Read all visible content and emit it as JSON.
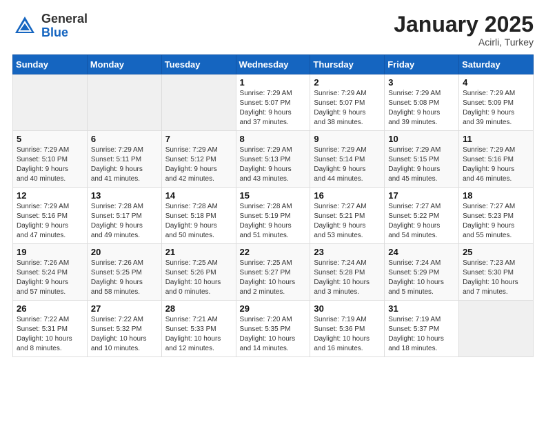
{
  "logo": {
    "general": "General",
    "blue": "Blue"
  },
  "header": {
    "month": "January 2025",
    "location": "Acirli, Turkey"
  },
  "weekdays": [
    "Sunday",
    "Monday",
    "Tuesday",
    "Wednesday",
    "Thursday",
    "Friday",
    "Saturday"
  ],
  "weeks": [
    [
      {
        "day": "",
        "info": ""
      },
      {
        "day": "",
        "info": ""
      },
      {
        "day": "",
        "info": ""
      },
      {
        "day": "1",
        "info": "Sunrise: 7:29 AM\nSunset: 5:07 PM\nDaylight: 9 hours\nand 37 minutes."
      },
      {
        "day": "2",
        "info": "Sunrise: 7:29 AM\nSunset: 5:07 PM\nDaylight: 9 hours\nand 38 minutes."
      },
      {
        "day": "3",
        "info": "Sunrise: 7:29 AM\nSunset: 5:08 PM\nDaylight: 9 hours\nand 39 minutes."
      },
      {
        "day": "4",
        "info": "Sunrise: 7:29 AM\nSunset: 5:09 PM\nDaylight: 9 hours\nand 39 minutes."
      }
    ],
    [
      {
        "day": "5",
        "info": "Sunrise: 7:29 AM\nSunset: 5:10 PM\nDaylight: 9 hours\nand 40 minutes."
      },
      {
        "day": "6",
        "info": "Sunrise: 7:29 AM\nSunset: 5:11 PM\nDaylight: 9 hours\nand 41 minutes."
      },
      {
        "day": "7",
        "info": "Sunrise: 7:29 AM\nSunset: 5:12 PM\nDaylight: 9 hours\nand 42 minutes."
      },
      {
        "day": "8",
        "info": "Sunrise: 7:29 AM\nSunset: 5:13 PM\nDaylight: 9 hours\nand 43 minutes."
      },
      {
        "day": "9",
        "info": "Sunrise: 7:29 AM\nSunset: 5:14 PM\nDaylight: 9 hours\nand 44 minutes."
      },
      {
        "day": "10",
        "info": "Sunrise: 7:29 AM\nSunset: 5:15 PM\nDaylight: 9 hours\nand 45 minutes."
      },
      {
        "day": "11",
        "info": "Sunrise: 7:29 AM\nSunset: 5:16 PM\nDaylight: 9 hours\nand 46 minutes."
      }
    ],
    [
      {
        "day": "12",
        "info": "Sunrise: 7:29 AM\nSunset: 5:16 PM\nDaylight: 9 hours\nand 47 minutes."
      },
      {
        "day": "13",
        "info": "Sunrise: 7:28 AM\nSunset: 5:17 PM\nDaylight: 9 hours\nand 49 minutes."
      },
      {
        "day": "14",
        "info": "Sunrise: 7:28 AM\nSunset: 5:18 PM\nDaylight: 9 hours\nand 50 minutes."
      },
      {
        "day": "15",
        "info": "Sunrise: 7:28 AM\nSunset: 5:19 PM\nDaylight: 9 hours\nand 51 minutes."
      },
      {
        "day": "16",
        "info": "Sunrise: 7:27 AM\nSunset: 5:21 PM\nDaylight: 9 hours\nand 53 minutes."
      },
      {
        "day": "17",
        "info": "Sunrise: 7:27 AM\nSunset: 5:22 PM\nDaylight: 9 hours\nand 54 minutes."
      },
      {
        "day": "18",
        "info": "Sunrise: 7:27 AM\nSunset: 5:23 PM\nDaylight: 9 hours\nand 55 minutes."
      }
    ],
    [
      {
        "day": "19",
        "info": "Sunrise: 7:26 AM\nSunset: 5:24 PM\nDaylight: 9 hours\nand 57 minutes."
      },
      {
        "day": "20",
        "info": "Sunrise: 7:26 AM\nSunset: 5:25 PM\nDaylight: 9 hours\nand 58 minutes."
      },
      {
        "day": "21",
        "info": "Sunrise: 7:25 AM\nSunset: 5:26 PM\nDaylight: 10 hours\nand 0 minutes."
      },
      {
        "day": "22",
        "info": "Sunrise: 7:25 AM\nSunset: 5:27 PM\nDaylight: 10 hours\nand 2 minutes."
      },
      {
        "day": "23",
        "info": "Sunrise: 7:24 AM\nSunset: 5:28 PM\nDaylight: 10 hours\nand 3 minutes."
      },
      {
        "day": "24",
        "info": "Sunrise: 7:24 AM\nSunset: 5:29 PM\nDaylight: 10 hours\nand 5 minutes."
      },
      {
        "day": "25",
        "info": "Sunrise: 7:23 AM\nSunset: 5:30 PM\nDaylight: 10 hours\nand 7 minutes."
      }
    ],
    [
      {
        "day": "26",
        "info": "Sunrise: 7:22 AM\nSunset: 5:31 PM\nDaylight: 10 hours\nand 8 minutes."
      },
      {
        "day": "27",
        "info": "Sunrise: 7:22 AM\nSunset: 5:32 PM\nDaylight: 10 hours\nand 10 minutes."
      },
      {
        "day": "28",
        "info": "Sunrise: 7:21 AM\nSunset: 5:33 PM\nDaylight: 10 hours\nand 12 minutes."
      },
      {
        "day": "29",
        "info": "Sunrise: 7:20 AM\nSunset: 5:35 PM\nDaylight: 10 hours\nand 14 minutes."
      },
      {
        "day": "30",
        "info": "Sunrise: 7:19 AM\nSunset: 5:36 PM\nDaylight: 10 hours\nand 16 minutes."
      },
      {
        "day": "31",
        "info": "Sunrise: 7:19 AM\nSunset: 5:37 PM\nDaylight: 10 hours\nand 18 minutes."
      },
      {
        "day": "",
        "info": ""
      }
    ]
  ]
}
